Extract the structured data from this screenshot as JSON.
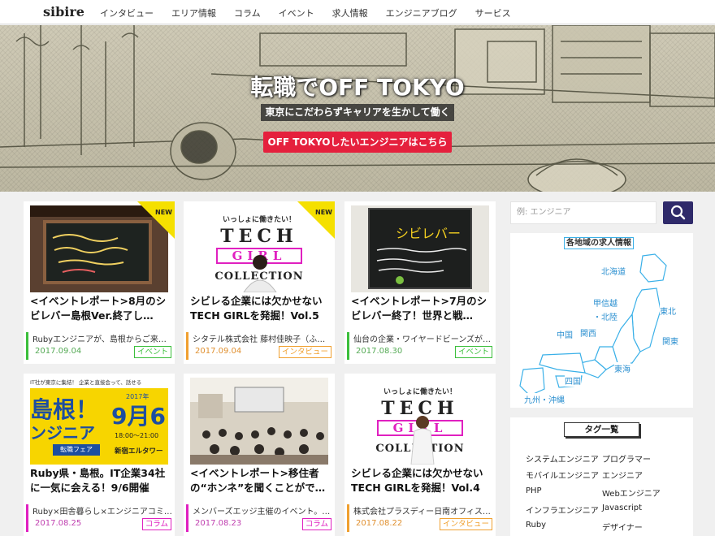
{
  "nav": {
    "logo": "sibire",
    "links": [
      "インタビュー",
      "エリア情報",
      "コラム",
      "イベント",
      "求人情報",
      "エンジニアブログ",
      "サービス"
    ]
  },
  "hero": {
    "title": "転職でOFF TOKYO",
    "subtitle": "東京にこだわらずキャリアを生かして働く",
    "cta": "OFF TOKYOしたいエンジニアはこちら"
  },
  "cards": [
    {
      "title": "<イベントレポート>8月のシビレバー島根Ver.終了し…",
      "excerpt": "Rubyエンジニアが、島根からご来店！",
      "date": "2017.09.04",
      "badge": "イベント",
      "new": "NEW",
      "category": "event"
    },
    {
      "title": "シビレる企業には欠かせない TECH GIRLを発掘！Vol.5",
      "excerpt": "シタテル株式会社 藤村佳映子（ふじ…",
      "date": "2017.09.04",
      "badge": "インタビュー",
      "new": "NEW",
      "category": "interview"
    },
    {
      "title": "<イベントレポート>7月のシビレバー終了！世界と戦…",
      "excerpt": "仙台の企業・ワイヤードビーンズが…",
      "date": "2017.08.30",
      "badge": "イベント",
      "new": "",
      "category": "event"
    },
    {
      "title": "Ruby県・島根。IT企業34社に一気に会える！9/6開催",
      "excerpt": "Ruby×田舎暮らし×エンジニアコミ…",
      "date": "2017.08.25",
      "badge": "コラム",
      "new": "",
      "category": "column"
    },
    {
      "title": "<イベントレポート>移住者の“ホンネ”を聞くことがで…",
      "excerpt": "メンバーズエッジ主催のイベント。…",
      "date": "2017.08.23",
      "badge": "コラム",
      "new": "",
      "category": "column"
    },
    {
      "title": "シビレる企業には欠かせない TECH GIRLを発掘！Vol.4",
      "excerpt": "株式会社プラスディー日南オフィス…",
      "date": "2017.08.22",
      "badge": "インタビュー",
      "new": "",
      "category": "interview"
    }
  ],
  "thumbs": {
    "techgirl": {
      "head": "いっしょに働きたい！",
      "l1": "TECH",
      "l2": "GIRL",
      "l3": "COLLECTION"
    },
    "shimane": {
      "top": "IT社が東京に集結！ 企業と直接会って、話せる",
      "big": "島根！",
      "sub": "ンジニア",
      "year": "2017年",
      "date": "9月6",
      "time": "18:00～21:00",
      "venue": "新宿エルタワー",
      "fair": "転職フェア"
    },
    "bar1": {
      "text": "シビレバー"
    },
    "bar2": {
      "text": "シビレバー"
    }
  },
  "sidebar": {
    "search_placeholder": "例: エンジニア",
    "map_title": "各地域の求人情報",
    "regions": [
      "北海道",
      "甲信越",
      "・北陸",
      "東北",
      "関東",
      "中国",
      "関西",
      "東海",
      "四国",
      "九州・沖縄"
    ],
    "tag_title": "タグ一覧",
    "tags": [
      "システムエンジニア",
      "プログラマー",
      "モバイルエンジニア",
      "エンジニア",
      "PHP",
      "Webエンジニア",
      "インフラエンジニア",
      "Javascript",
      "Ruby",
      "デザイナー"
    ]
  },
  "colors": {
    "cta": "#e5203d",
    "event": "#3bbf3b",
    "interview": "#f0a030",
    "column": "#e020c0",
    "search_button": "#2f2a6a",
    "map": "#3ab0e8"
  }
}
